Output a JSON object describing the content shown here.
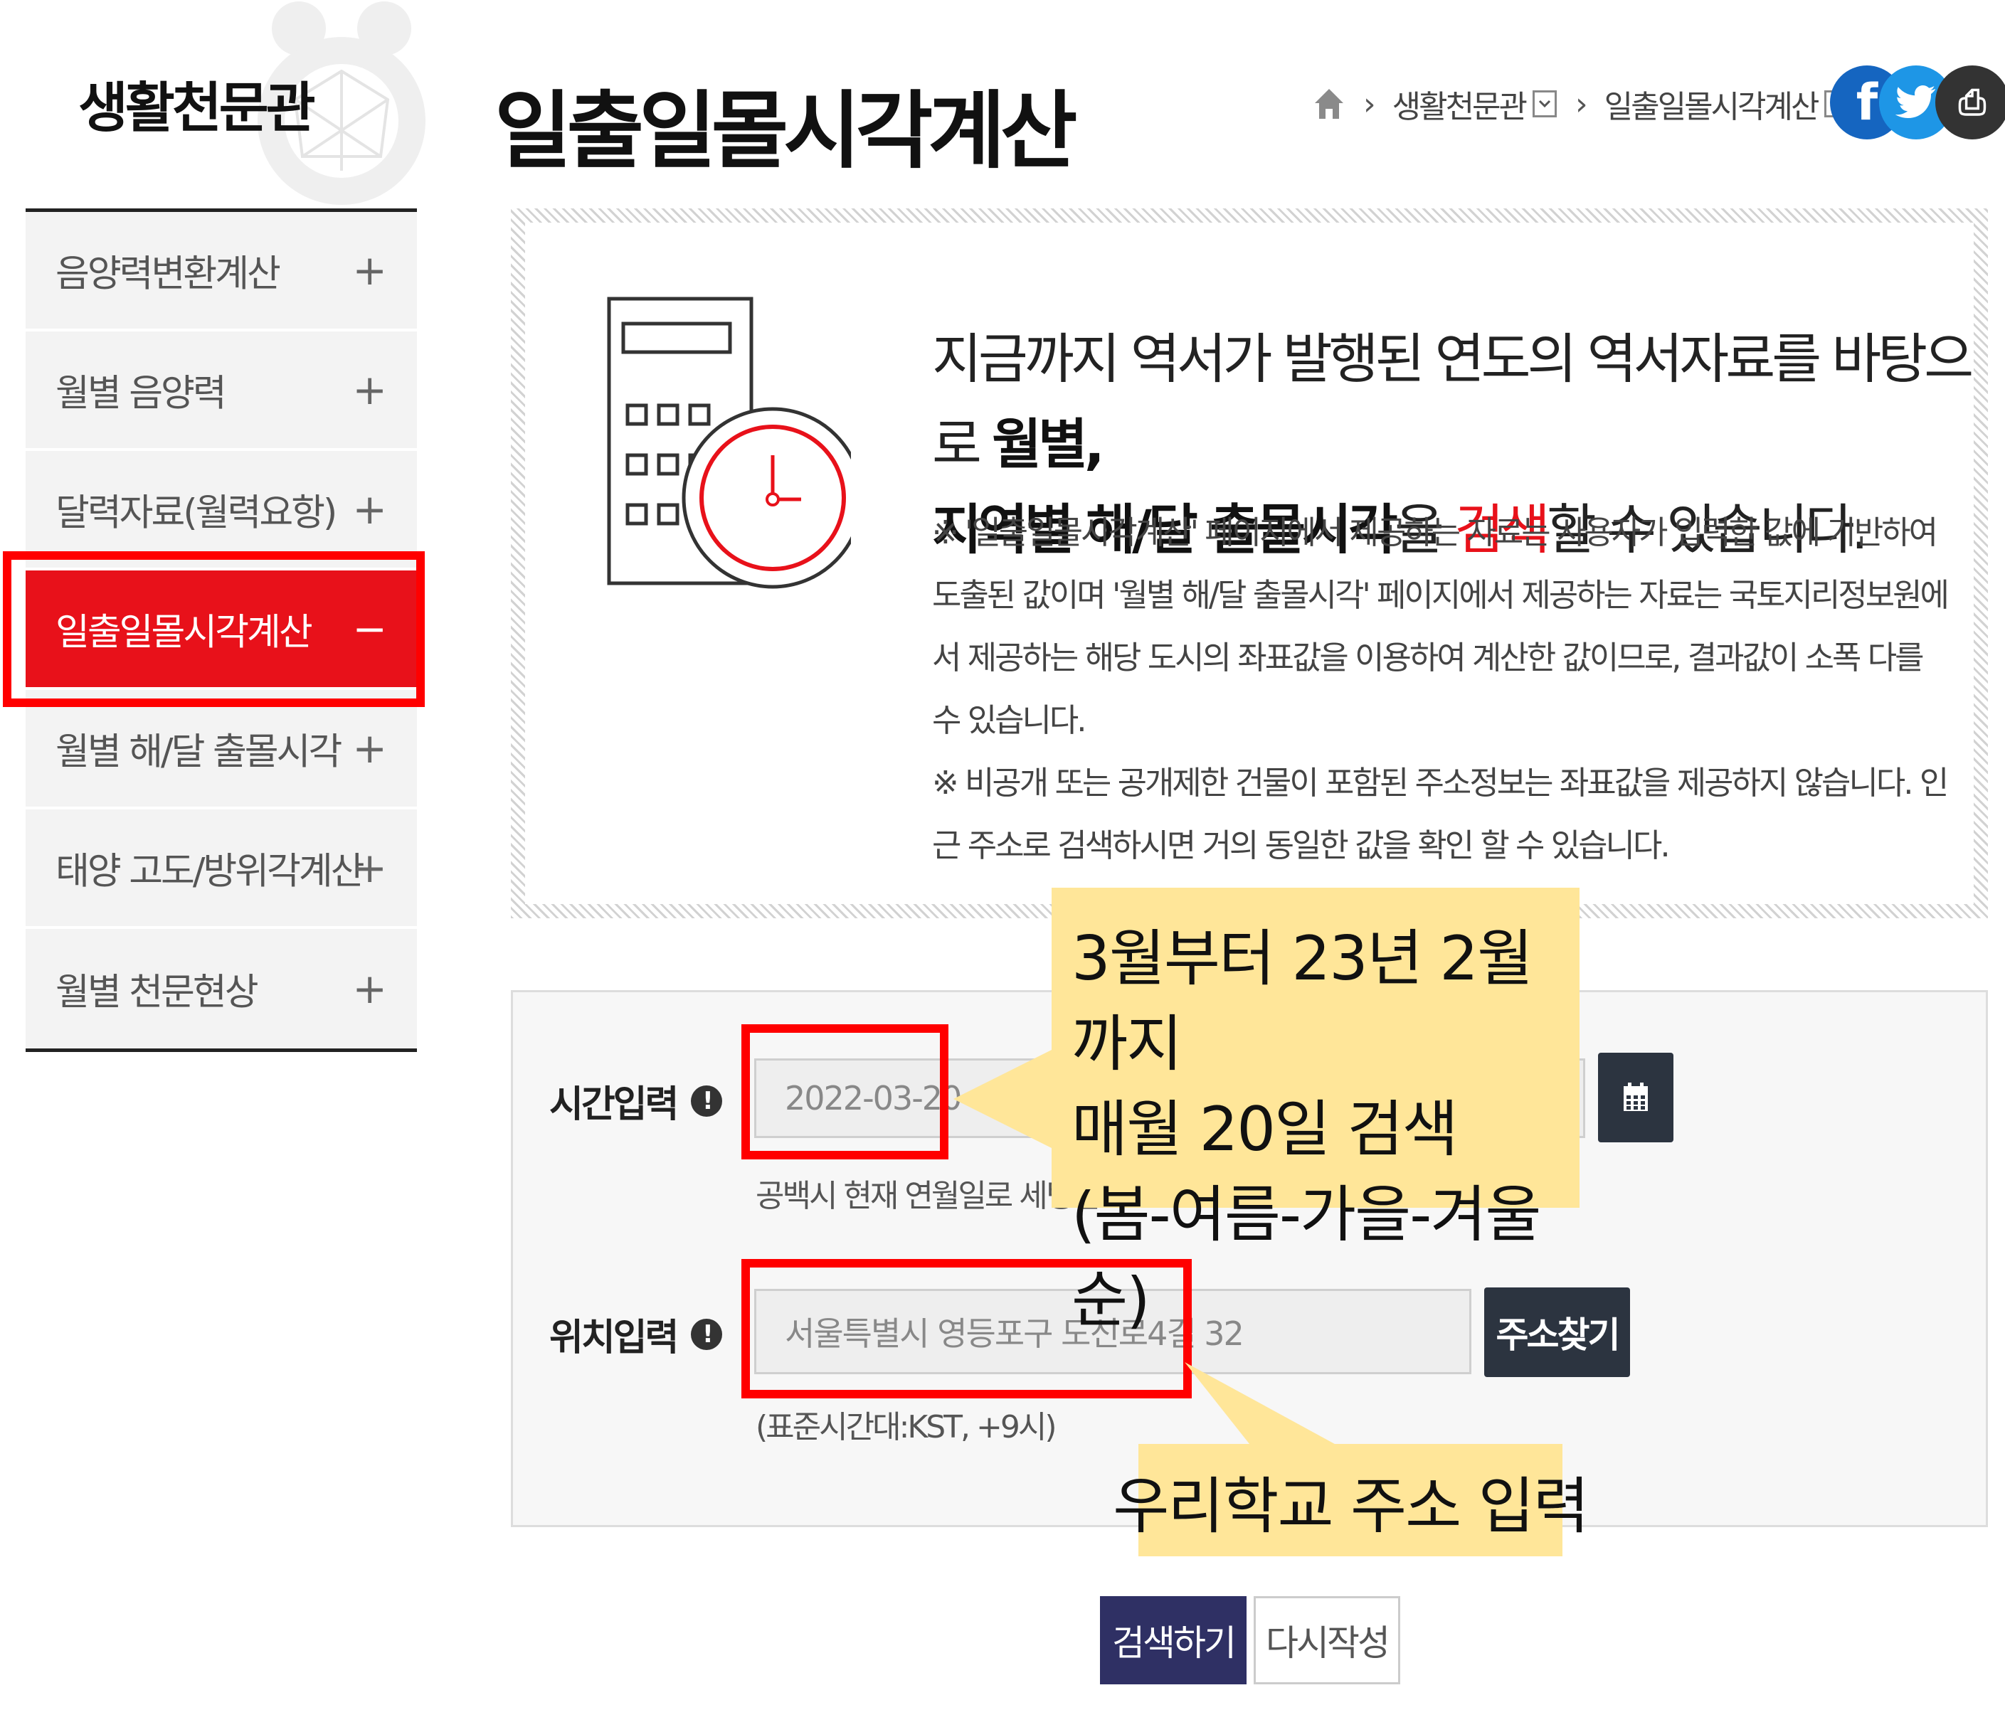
{
  "sidebar": {
    "title": "생활천문관",
    "items": [
      {
        "label": "음양력변환계산",
        "sign": "+"
      },
      {
        "label": "월별 음양력",
        "sign": "+"
      },
      {
        "label": "달력자료(월력요항)",
        "sign": "+"
      },
      {
        "label": "일출일몰시각계산",
        "sign": "−"
      },
      {
        "label": "월별 해/달 출몰시각",
        "sign": "+"
      },
      {
        "label": "태양 고도/방위각계산",
        "sign": "+"
      },
      {
        "label": "월별 천문현상",
        "sign": "+"
      }
    ]
  },
  "header": {
    "title": "일출일몰시각계산",
    "breadcrumb": {
      "sep": "›",
      "level1": "생활천문관",
      "level2": "일출일몰시각계산"
    },
    "social": {
      "facebook": "f",
      "twitter": "t",
      "print": "⎙"
    }
  },
  "info": {
    "headline_part1": "지금까지 역서가 발행된 연도의 역서자료를 바탕으로 ",
    "headline_bold1": "월별,",
    "headline_bold2": "지역별 해/달 출몰시각",
    "headline_part2": "을 ",
    "headline_red": "검색",
    "headline_part3": "할 수 있습니다.",
    "note1": "※ '일출일몰시각계산' 페이지에서 제공하는 자료는 사용자가 입력한 값에 기반하여 도출된 값이며 '월별 해/달 출몰시각' 페이지에서 제공하는 자료는 국토지리정보원에서 제공하는 해당 도시의 좌표값을 이용하여 계산한 값이므로, 결과값이 소폭 다를 수 있습니다.",
    "note2": "※ 비공개 또는 공개제한 건물이 포함된 주소정보는 좌표값을 제공하지 않습니다. 인근 주소로 검색하시면 거의 동일한 값을 확인 할 수 있습니다."
  },
  "form": {
    "time_label": "시간입력",
    "time_value": "2022-03-20",
    "time_hint": "공백시 현재 연월일로 세팅됩니",
    "location_label": "위치입력",
    "location_value": "서울특별시 영등포구 도신로4길 32",
    "location_hint": "(표준시간대:KST, +9시)",
    "address_button": "주소찾기",
    "warn_symbol": "!"
  },
  "callouts": {
    "date_note_line1": "3월부터 23년 2월까지",
    "date_note_line2": "매월 20일 검색",
    "date_note_line3": "(봄-여름-가을-겨울 순)",
    "address_note": "우리학교 주소 입력"
  },
  "actions": {
    "search": "검색하기",
    "reset": "다시작성"
  },
  "colors": {
    "accent_red": "#e8111a",
    "highlight_red": "#ff0000",
    "callout_yellow": "#ffe699",
    "dark_button": "#2c3440",
    "search_button": "#2f3064"
  },
  "icons": {
    "home": "home-icon",
    "calendar": "calendar-icon",
    "calculator": "calculator-clock-icon"
  }
}
